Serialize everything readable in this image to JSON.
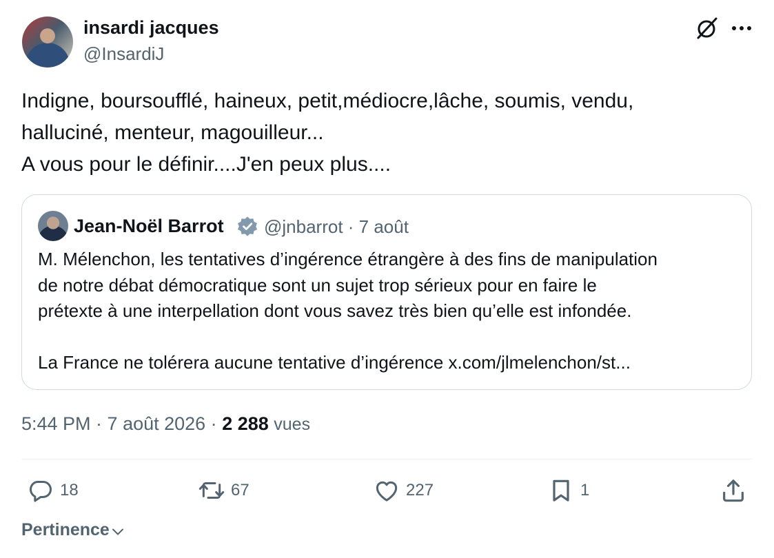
{
  "author": {
    "display_name": "insardi jacques",
    "handle": "@InsardiJ"
  },
  "tweet": {
    "lines": [
      "Indigne, boursoufflé, haineux, petit,médiocre,lâche, soumis, vendu,",
      "halluciné, menteur, magouilleur...",
      "A vous pour le définir....J'en peux plus...."
    ]
  },
  "quote": {
    "display_name": "Jean-Noël Barrot",
    "meta": "@jnbarrot · 7 août",
    "lines": [
      "M. Mélenchon, les tentatives d’ingérence étrangère à des fins de manipulation",
      "de notre débat démocratique sont un sujet trop sérieux pour en faire le",
      "prétexte à une interpellation dont vous savez très bien qu’elle est infondée.",
      "",
      "La France ne tolérera aucune tentative d’ingérence x.com/jlmelenchon/st..."
    ]
  },
  "timestamp": {
    "time": "5:44 PM · 7 août 2026 · ",
    "views_count": "2 288",
    "views_label": "vues"
  },
  "actions": {
    "replies": "18",
    "reposts": "67",
    "likes": "227",
    "bookmarks": "1"
  },
  "sort": {
    "label": "Pertinence"
  },
  "icons": {
    "header_right": [
      "grok-icon",
      "more-icon"
    ],
    "actions": [
      "reply-icon",
      "repost-icon",
      "like-icon",
      "bookmark-icon",
      "share-icon"
    ],
    "badge": "verified-icon"
  },
  "colors": {
    "text": "#0f1419",
    "secondary": "#536471",
    "border": "#cfd9de",
    "verified_badge": "#829aab"
  }
}
